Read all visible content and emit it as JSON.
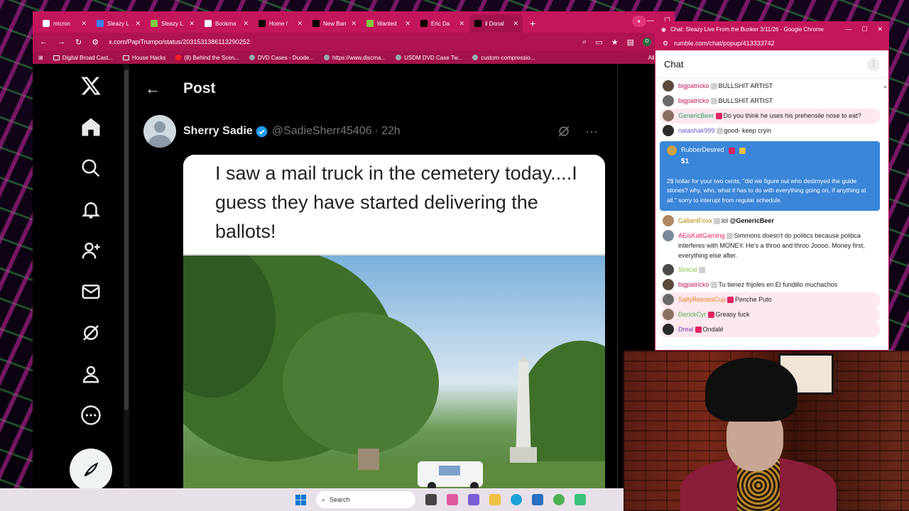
{
  "browser": {
    "tabs": [
      {
        "label": "micron",
        "favicon": "google-icon",
        "color": "#ffffff"
      },
      {
        "label": "Sleazy L",
        "favicon": "b-icon",
        "color": "#3b82f6"
      },
      {
        "label": "Sleazy L",
        "favicon": "rumble-icon",
        "color": "#85c742"
      },
      {
        "label": "Bookma",
        "favicon": "star-icon",
        "color": "#ffffff"
      },
      {
        "label": "Home /",
        "favicon": "x-icon",
        "color": "#000000"
      },
      {
        "label": "New Ban",
        "favicon": "x-icon",
        "color": "#000000"
      },
      {
        "label": "Wanted",
        "favicon": "rumble-icon",
        "color": "#85c742"
      },
      {
        "label": "Eric Da",
        "favicon": "x-icon",
        "color": "#000000"
      },
      {
        "label": "il Donal",
        "favicon": "x-icon",
        "color": "#000000",
        "active": true
      }
    ],
    "new_tab": "+",
    "url": "x.com/PapiTrumpo/status/2031531386113290252",
    "bookmarks": [
      {
        "label": "Digital Broad Cast...",
        "icon": "folder-icon"
      },
      {
        "label": "House Hacks",
        "icon": "folder-icon"
      },
      {
        "label": "(8) Behind the Scen...",
        "icon": "youtube-icon"
      },
      {
        "label": "DVD Cases - Duode...",
        "icon": "site-icon"
      },
      {
        "label": "https://www.discma...",
        "icon": "site-icon"
      },
      {
        "label": "USDM DVD Case Tw...",
        "icon": "site-icon"
      },
      {
        "label": "custom-compressio...",
        "icon": "site-icon"
      }
    ],
    "all_bookmarks": "All Book",
    "profile_initial": "D"
  },
  "x": {
    "header_title": "Post",
    "author_name": "Sherry Sadie",
    "handle": "@SadieSherr45406",
    "separator": "·",
    "time": "22h",
    "meme_text": "I saw a mail truck in the cemetery today....I guess they have started delivering the ballots!",
    "nav": [
      "x-logo-icon",
      "home-icon",
      "search-icon",
      "bell-icon",
      "add-user-icon",
      "mail-icon",
      "grok-icon",
      "profile-icon",
      "more-icon"
    ],
    "compose_icon": "compose-icon"
  },
  "chat": {
    "window_title": "Chat: Sleazy Live From the Bunker 3/11/26 - Google Chrome",
    "url": "rumble.com/chat/popup/413333742",
    "heading": "Chat",
    "messages": [
      {
        "user": "bigpatricko",
        "text": "BULLSHIT ARTIST",
        "user_color": "#c2185b",
        "highlight": false
      },
      {
        "user": "bigpatricko",
        "text": "BULLSHIT ARTIST",
        "user_color": "#c2185b",
        "highlight": false
      },
      {
        "user": "GenericBeer",
        "text": "Do you think he uses his prehensile nose to eat?",
        "user_color": "#2e9d6b",
        "highlight": true
      },
      {
        "user": "natashak999",
        "text": "good- keep cryin",
        "user_color": "#6a5acd",
        "highlight": false
      }
    ],
    "rant": {
      "user": "RubberDesired",
      "amount": "$1",
      "text": "2$ hollar for your two cents, \"did we figure out who destroyed the guide stones? why, who, what it has to do with everything going on, if anything at all.\" sorry to interupt from regular schedule.",
      "color": "#3a86d8"
    },
    "messages_after": [
      {
        "user": "GallantFoxx",
        "text": "lol",
        "mention": "@GenericBeer",
        "user_color": "#b8860b",
        "highlight": false
      },
      {
        "user": "AEisKaltGaming",
        "text": "Simmons doesn't do politics because politica interferes with MONEY. He's a throo and throo Joooo. Money first, everything else after.",
        "user_color": "#e91e63",
        "highlight": false
      },
      {
        "user": "Sinical",
        "text": "",
        "user_color": "#8bc34a",
        "highlight": false
      },
      {
        "user": "bigpatricko",
        "text": "Tu tienez frijoles en El fundillo muchachos",
        "user_color": "#c2185b",
        "highlight": false
      },
      {
        "user": "SaltyReesesCup",
        "text": "Penche Puto",
        "user_color": "#e67e22",
        "highlight": true
      },
      {
        "user": "DerickCyr",
        "text": "Greasy fuck",
        "user_color": "#4caf50",
        "highlight": true
      },
      {
        "user": "Dreal",
        "text": "Ondalé",
        "user_color": "#7b3fb5",
        "highlight": true
      }
    ]
  },
  "taskbar": {
    "search_placeholder": "Search"
  }
}
